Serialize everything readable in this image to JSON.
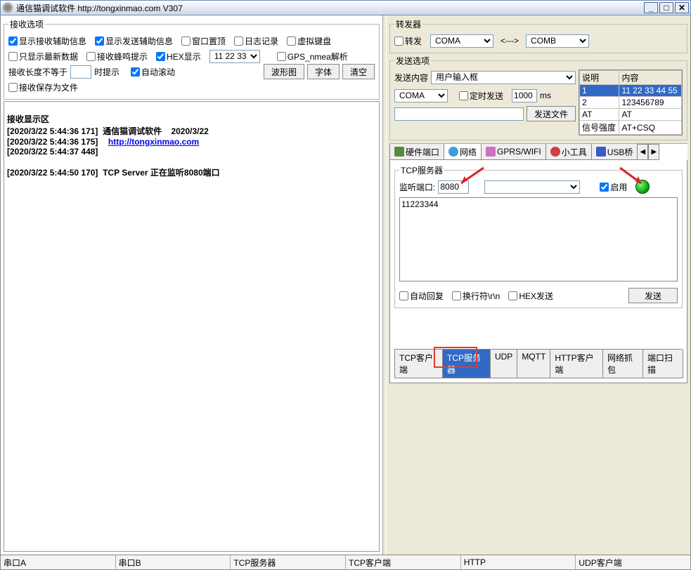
{
  "window": {
    "title": "通信猫调试软件  http://tongxinmao.com  V307"
  },
  "recv_options": {
    "legend": "接收选项",
    "show_recv_aux": "显示接收辅助信息",
    "show_send_aux": "显示发送辅助信息",
    "always_top": "窗口置顶",
    "log": "日志记录",
    "vkeyboard": "虚拟键盘",
    "only_new": "只显示最新数据",
    "beep": "接收蜂鸣提示",
    "hex_display": "HEX显示",
    "hex_field": "11 22 33",
    "gps": "GPS_nmea解析",
    "len_ne": "接收长度不等于",
    "len_hint": "时提示",
    "autoscroll": "自动滚动",
    "btn_wave": "波形图",
    "btn_font": "字体",
    "btn_clear": "清空",
    "save_file": "接收保存为文件"
  },
  "recv_display": {
    "title": "接收显示区",
    "line1_ts": "[2020/3/22 5:44:36 171]",
    "line1_txt": "  通信猫调试软件    2020/3/22",
    "line2_ts": "[2020/3/22 5:44:36 175]",
    "line2_link": "http://tongxinmao.com",
    "line3_ts": "[2020/3/22 5:44:37 448]",
    "line4_ts": "[2020/3/22 5:44:50 170]",
    "line4_txt": "  TCP Server 正在监听8080端口"
  },
  "forwarder": {
    "legend": "转发器",
    "forward": "转发",
    "from": "COMA",
    "arrow": "<--->",
    "to": "COMB"
  },
  "send_options": {
    "legend": "发送选项",
    "content_label": "发送内容",
    "content_select": "用户输入框",
    "port_select": "COMA",
    "timed": "定时发送",
    "interval": "1000",
    "ms": "ms",
    "btn_sendfile": "发送文件",
    "grid": {
      "h1": "说明",
      "h2": "内容",
      "rows": [
        {
          "c1": "1",
          "c2": "11 22 33 44 55",
          "sel": true
        },
        {
          "c1": "2",
          "c2": "123456789"
        },
        {
          "c1": "AT",
          "c2": "AT"
        },
        {
          "c1": "信号强度",
          "c2": "AT+CSQ"
        }
      ]
    }
  },
  "main_tabs": {
    "hw": "硬件端口",
    "net": "网络",
    "gprs": "GPRS/WIFI",
    "tool": "小工具",
    "usb": "USB桥"
  },
  "net_subtabs": {
    "tcp_client": "TCP客户端",
    "tcp_server": "TCP服务器",
    "udp": "UDP",
    "mqtt": "MQTT",
    "http_client": "HTTP客户端",
    "capture": "网络抓包",
    "portscan": "端口扫描"
  },
  "tcp_server": {
    "legend": "TCP服务器",
    "listen_label": "监听端口:",
    "port": "8080",
    "enable": "启用",
    "textarea": "11223344",
    "auto_reply": "自动回复",
    "crlf": "换行符\\r\\n",
    "hex_send": "HEX发送",
    "btn_send": "发送"
  },
  "statusbar": {
    "c1": "串口A",
    "c2": "串口B",
    "c3": "TCP服务器",
    "c4": "TCP客户端",
    "c5": "HTTP",
    "c6": "UDP客户端"
  }
}
